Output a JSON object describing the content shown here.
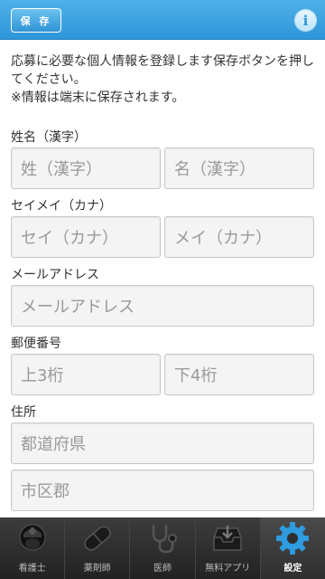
{
  "header": {
    "save_label": "保 存",
    "info_glyph": "i",
    "colors": {
      "bar": "#2d95d9",
      "accent": "#4fb1e8"
    }
  },
  "intro": {
    "text": "応募に必要な個人情報を登録します保存ボタンを押してください。",
    "note": "※情報は端末に保存されます。"
  },
  "form": {
    "name_kanji": {
      "label": "姓名（漢字）",
      "last_placeholder": "姓（漢字）",
      "first_placeholder": "名（漢字）"
    },
    "name_kana": {
      "label": "セイメイ（カナ）",
      "last_placeholder": "セイ（カナ）",
      "first_placeholder": "メイ（カナ）"
    },
    "email": {
      "label": "メールアドレス",
      "placeholder": "メールアドレス"
    },
    "postal": {
      "label": "郵便番号",
      "upper_placeholder": "上3桁",
      "lower_placeholder": "下4桁"
    },
    "address": {
      "label": "住所",
      "prefecture_placeholder": "都道府県",
      "city_placeholder": "市区郡"
    }
  },
  "tabs": [
    {
      "label": "看護士",
      "icon": "nurse-icon",
      "active": false
    },
    {
      "label": "薬剤師",
      "icon": "pill-icon",
      "active": false
    },
    {
      "label": "医師",
      "icon": "stethoscope-icon",
      "active": false
    },
    {
      "label": "無料アプリ",
      "icon": "download-tray-icon",
      "active": false
    },
    {
      "label": "設定",
      "icon": "gear-icon",
      "active": true
    }
  ]
}
